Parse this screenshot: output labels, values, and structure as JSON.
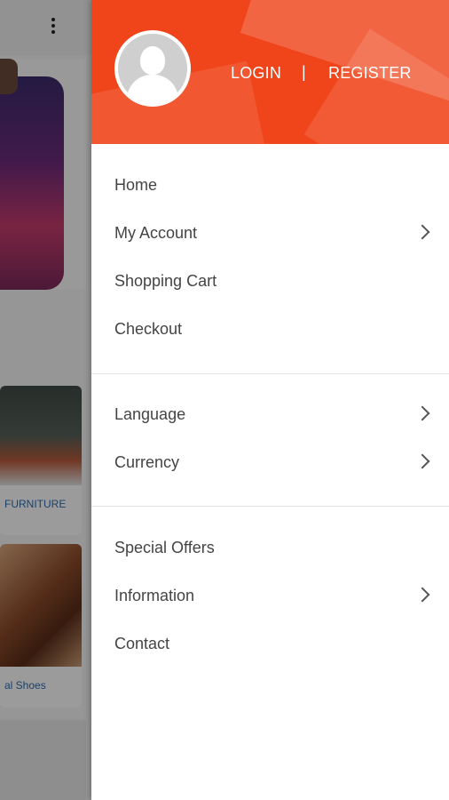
{
  "background_app": {
    "card1_label": "FURNITURE",
    "card2_label": "al Shoes"
  },
  "drawer": {
    "header": {
      "login_label": "LOGIN",
      "separator": "|",
      "register_label": "REGISTER"
    },
    "sections": [
      {
        "items": [
          {
            "label": "Home",
            "has_chevron": false
          },
          {
            "label": "My Account",
            "has_chevron": true
          },
          {
            "label": "Shopping Cart",
            "has_chevron": false
          },
          {
            "label": "Checkout",
            "has_chevron": false
          }
        ]
      },
      {
        "items": [
          {
            "label": "Language",
            "has_chevron": true
          },
          {
            "label": "Currency",
            "has_chevron": true
          }
        ]
      },
      {
        "items": [
          {
            "label": "Special Offers",
            "has_chevron": false
          },
          {
            "label": "Information",
            "has_chevron": true
          },
          {
            "label": "Contact",
            "has_chevron": false
          }
        ]
      }
    ]
  },
  "colors": {
    "header_orange": "#f0441a",
    "menu_text": "#444444",
    "link_blue": "#2e6aa8"
  },
  "icons": [
    "kebab-menu-icon",
    "avatar-icon",
    "chevron-right-icon"
  ]
}
